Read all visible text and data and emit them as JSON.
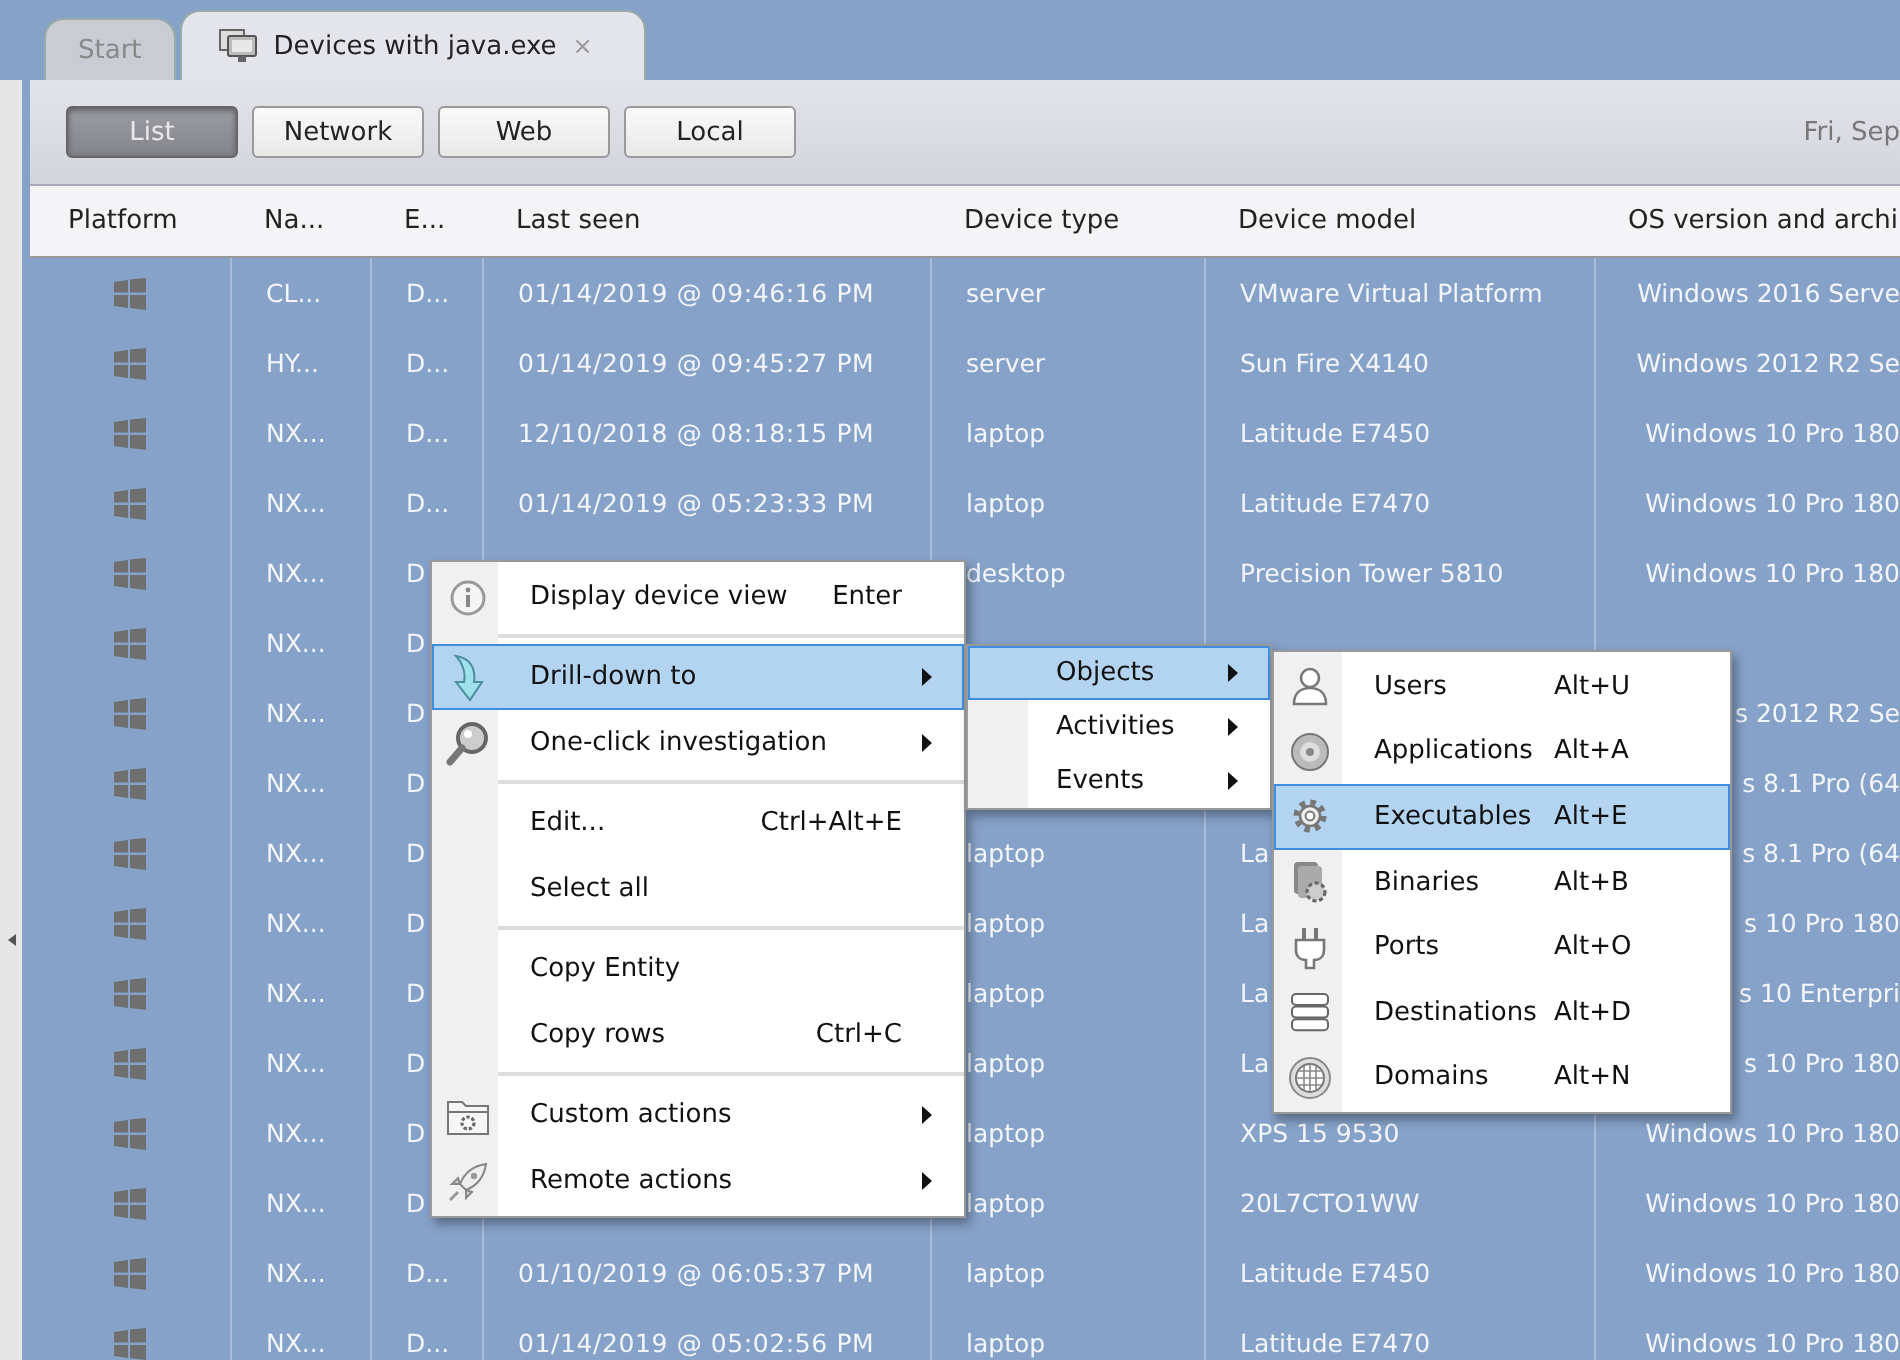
{
  "tabs": [
    {
      "label": "Start",
      "selected": false
    },
    {
      "label": "Devices with java.exe",
      "selected": true,
      "close": "×"
    }
  ],
  "view_buttons": [
    {
      "label": "List",
      "selected": true
    },
    {
      "label": "Network",
      "selected": false
    },
    {
      "label": "Web",
      "selected": false
    },
    {
      "label": "Local",
      "selected": false
    }
  ],
  "date": "Fri, Sep",
  "table": {
    "columns": [
      "Platform",
      "Na...",
      "E...",
      "Last seen",
      "Device type",
      "Device model",
      "OS version and archi"
    ],
    "rows": [
      {
        "selected": true,
        "column_2": "CL...",
        "column_3": "D...",
        "last_seen": "01/14/2019 @ 09:46:16 PM",
        "device_type": "server",
        "device_model": "VMware Virtual Platform",
        "os_version": "Windows 2016 Serve"
      },
      {
        "selected": true,
        "column_2": "HY...",
        "column_3": "D...",
        "last_seen": "01/14/2019 @ 09:45:27 PM",
        "device_type": "server",
        "device_model": "Sun Fire X4140",
        "os_version": "Windows 2012 R2 Se"
      },
      {
        "selected": true,
        "column_2": "NX...",
        "column_3": "D...",
        "last_seen": "12/10/2018 @ 08:18:15 PM",
        "device_type": "laptop",
        "device_model": "Latitude E7450",
        "os_version": "Windows 10 Pro 180"
      },
      {
        "selected": true,
        "column_2": "NX...",
        "column_3": "D...",
        "last_seen": "01/14/2019 @ 05:23:33 PM",
        "device_type": "laptop",
        "device_model": "Latitude E7470",
        "os_version": "Windows 10 Pro 180"
      },
      {
        "selected": true,
        "column_2": "NX...",
        "column_3": "D",
        "device_type": "desktop",
        "device_model": "Precision Tower 5810",
        "os_version": "Windows 10 Pro 180"
      },
      {
        "selected": true,
        "column_2": "NX...",
        "column_3": "D"
      },
      {
        "selected": true,
        "column_2": "NX...",
        "column_3": "D",
        "os_version": "s 2012 R2 Se"
      },
      {
        "selected": true,
        "column_2": "NX...",
        "column_3": "D",
        "os_version": "s 8.1 Pro (64"
      },
      {
        "selected": true,
        "column_2": "NX...",
        "column_3": "D",
        "device_type": "laptop",
        "device_model": "La",
        "os_version": "s 8.1 Pro (64"
      },
      {
        "selected": true,
        "column_2": "NX...",
        "column_3": "D",
        "device_type": "laptop",
        "device_model": "La",
        "os_version": "s 10 Pro 180"
      },
      {
        "selected": true,
        "column_2": "NX...",
        "column_3": "D",
        "device_type": "laptop",
        "device_model": "La",
        "os_version": "s 10 Enterpri"
      },
      {
        "selected": true,
        "column_2": "NX...",
        "column_3": "D",
        "device_type": "laptop",
        "device_model": "La",
        "os_version": "s 10 Pro 180"
      },
      {
        "selected": true,
        "column_2": "NX...",
        "column_3": "D",
        "device_type": "laptop",
        "device_model": "XPS 15 9530",
        "os_version": "Windows 10 Pro 180"
      },
      {
        "selected": true,
        "column_2": "NX...",
        "column_3": "D",
        "device_type": "laptop",
        "device_model": "20L7CTO1WW",
        "os_version": "Windows 10 Pro 180"
      },
      {
        "selected": true,
        "column_2": "NX...",
        "column_3": "D...",
        "last_seen": "01/10/2019 @ 06:05:37 PM",
        "device_type": "laptop",
        "device_model": "Latitude E7450",
        "os_version": "Windows 10 Pro 180"
      },
      {
        "selected": true,
        "column_2": "NX...",
        "column_3": "D...",
        "last_seen": "01/14/2019 @ 05:02:56 PM",
        "device_type": "laptop",
        "device_model": "Latitude E7470",
        "os_version": "Windows 10 Pro 180"
      }
    ]
  },
  "context_menu": {
    "items": [
      {
        "kind": "item",
        "label": "Display device view",
        "shortcut": "Enter",
        "submenu": false,
        "selected": false
      },
      {
        "kind": "separator"
      },
      {
        "kind": "item",
        "label": "Drill-down to",
        "submenu": true,
        "selected": true
      },
      {
        "kind": "item",
        "label": "One-click investigation",
        "submenu": true,
        "selected": false
      },
      {
        "kind": "separator"
      },
      {
        "kind": "item",
        "label": "Edit...",
        "shortcut": "Ctrl+Alt+E",
        "submenu": false,
        "selected": false
      },
      {
        "kind": "item",
        "label": "Select all",
        "submenu": false,
        "selected": false
      },
      {
        "kind": "separator"
      },
      {
        "kind": "item",
        "label": "Copy Entity",
        "submenu": false,
        "selected": false
      },
      {
        "kind": "item",
        "label": "Copy rows",
        "shortcut": "Ctrl+C",
        "submenu": false,
        "selected": false
      },
      {
        "kind": "separator"
      },
      {
        "kind": "item",
        "label": "Custom actions",
        "submenu": true,
        "selected": false
      },
      {
        "kind": "item",
        "label": "Remote actions",
        "submenu": true,
        "selected": false
      }
    ]
  },
  "drill_down_menu": {
    "items": [
      {
        "label": "Objects",
        "submenu": true,
        "selected": true
      },
      {
        "label": "Activities",
        "submenu": true,
        "selected": false
      },
      {
        "label": "Events",
        "submenu": true,
        "selected": false
      }
    ]
  },
  "objects_menu": {
    "items": [
      {
        "label": "Users",
        "shortcut": "Alt+U",
        "selected": false
      },
      {
        "label": "Applications",
        "shortcut": "Alt+A",
        "selected": false
      },
      {
        "label": "Executables",
        "shortcut": "Alt+E",
        "selected": true
      },
      {
        "label": "Binaries",
        "shortcut": "Alt+B",
        "selected": false
      },
      {
        "label": "Ports",
        "shortcut": "Alt+O",
        "selected": false
      },
      {
        "label": "Destinations",
        "shortcut": "Alt+D",
        "selected": false
      },
      {
        "label": "Domains",
        "shortcut": "Alt+N",
        "selected": false
      }
    ]
  }
}
